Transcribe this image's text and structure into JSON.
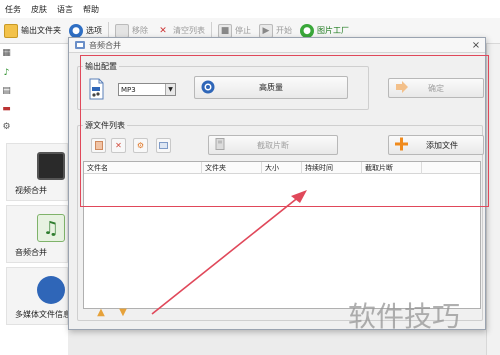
{
  "menu": [
    "任务",
    "皮肤",
    "语言",
    "帮助"
  ],
  "toolbar": {
    "output_folder": "输出文件夹",
    "options": "选项",
    "remove": "移除",
    "clear_list": "清空列表",
    "stop": "停止",
    "start": "开始",
    "image_factory": "图片工厂"
  },
  "sidebar": {
    "video_merge": "视频合并",
    "audio_merge": "音频合并",
    "media_info": "多媒体文件信息"
  },
  "dialog": {
    "title": "音频合并",
    "close_glyph": "×",
    "output_config": {
      "label": "输出配置",
      "format": "MP3",
      "quality_button": "高质量",
      "ok_button": "确定"
    },
    "source_list": {
      "label": "源文件列表",
      "clip_button": "截取片断",
      "add_file_button": "添加文件",
      "columns": [
        "文件名",
        "文件夹",
        "大小",
        "持续时间",
        "截取片断"
      ]
    }
  },
  "watermark": "软件技巧",
  "colors": {
    "highlight_box": "#e0485a",
    "arrow": "#e0485a",
    "add_icon": "#f08a1c"
  }
}
